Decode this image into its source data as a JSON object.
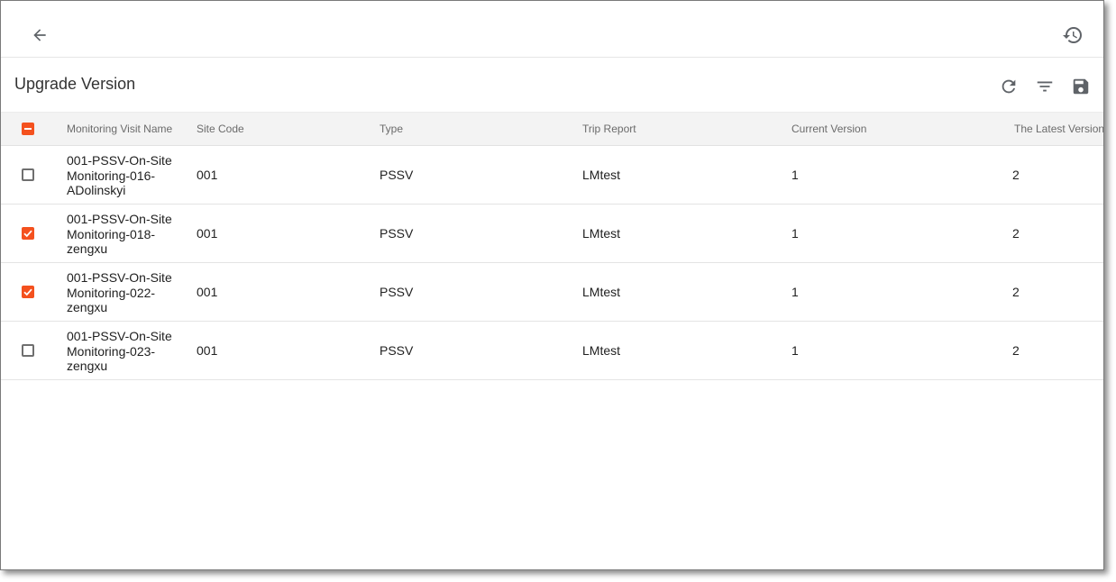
{
  "page": {
    "title": "Upgrade Version"
  },
  "icons": {
    "back": "arrow-left-icon",
    "history": "history-icon",
    "refresh": "refresh-icon",
    "filter": "filter-icon",
    "save": "save-icon"
  },
  "colors": {
    "accent": "#f4511e",
    "header_bg": "#f3f3f3"
  },
  "table": {
    "select_all_state": "indeterminate",
    "columns": [
      "Monitoring Visit Name",
      "Site Code",
      "Type",
      "Trip Report",
      "Current Version",
      "The Latest Version"
    ],
    "rows": [
      {
        "checked": false,
        "name_lines": [
          "001-PSSV-On-Site",
          "Monitoring-016-",
          "ADolinskyi"
        ],
        "site_code": "001",
        "type": "PSSV",
        "trip_report": "LMtest",
        "current_version": "1",
        "latest_version": "2"
      },
      {
        "checked": true,
        "name_lines": [
          "001-PSSV-On-Site",
          "Monitoring-018-",
          "zengxu"
        ],
        "site_code": "001",
        "type": "PSSV",
        "trip_report": "LMtest",
        "current_version": "1",
        "latest_version": "2"
      },
      {
        "checked": true,
        "name_lines": [
          "001-PSSV-On-Site",
          "Monitoring-022-",
          "zengxu"
        ],
        "site_code": "001",
        "type": "PSSV",
        "trip_report": "LMtest",
        "current_version": "1",
        "latest_version": "2"
      },
      {
        "checked": false,
        "name_lines": [
          "001-PSSV-On-Site",
          "Monitoring-023-",
          "zengxu"
        ],
        "site_code": "001",
        "type": "PSSV",
        "trip_report": "LMtest",
        "current_version": "1",
        "latest_version": "2"
      }
    ]
  }
}
